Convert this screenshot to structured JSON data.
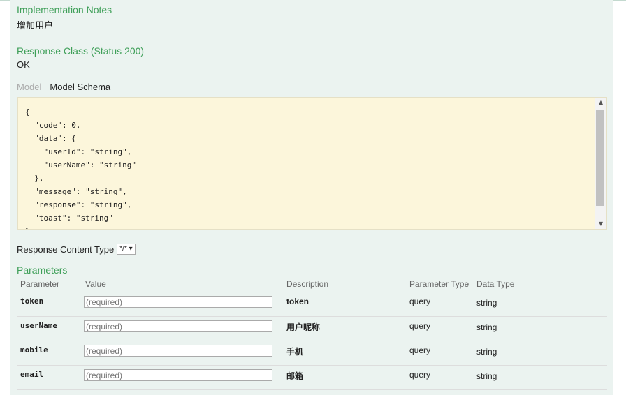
{
  "implementation_notes": {
    "heading": "Implementation Notes",
    "text": "增加用户"
  },
  "response_class": {
    "heading": "Response Class (Status 200)",
    "text": "OK"
  },
  "model_tabs": {
    "model": "Model",
    "schema": "Model Schema"
  },
  "schema_lines": [
    "{",
    "  \"code\": 0,",
    "  \"data\": {",
    "    \"userId\": \"string\",",
    "    \"userName\": \"string\"",
    "  },",
    "  \"message\": \"string\",",
    "  \"response\": \"string\",",
    "  \"toast\": \"string\"",
    "}"
  ],
  "response_content_type": {
    "label": "Response Content Type",
    "selected": "*/*"
  },
  "parameters": {
    "heading": "Parameters",
    "columns": [
      "Parameter",
      "Value",
      "Description",
      "Parameter Type",
      "Data Type"
    ],
    "rows": [
      {
        "name": "token",
        "placeholder": "(required)",
        "description": "token",
        "param_type": "query",
        "data_type": "string"
      },
      {
        "name": "userName",
        "placeholder": "(required)",
        "description": "用户昵称",
        "param_type": "query",
        "data_type": "string"
      },
      {
        "name": "mobile",
        "placeholder": "(required)",
        "description": "手机",
        "param_type": "query",
        "data_type": "string"
      },
      {
        "name": "email",
        "placeholder": "(required)",
        "description": "邮箱",
        "param_type": "query",
        "data_type": "string"
      }
    ]
  },
  "colors": {
    "heading_green": "#3e9f58",
    "panel_bg": "#ebf3f0",
    "snippet_bg": "#fcf6db"
  }
}
